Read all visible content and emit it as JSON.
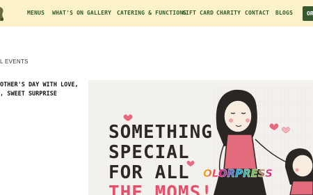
{
  "header": {
    "nav_items": [
      "MENUS",
      "WHAT'S ON",
      "GALLERY",
      "CATERING & FUNCTIONS",
      "GIFT CARD",
      "CHARITY",
      "CONTACT",
      "BLOGS"
    ],
    "order_button_label": "OR"
  },
  "breadcrumb": {
    "text": "L EVENTS"
  },
  "post": {
    "title": "OTHER'S DAY WITH LOVE,\n, SWEET SURPRISE"
  },
  "hero": {
    "lines": [
      "SOMETHING",
      "SPECIAL",
      "FOR ALL",
      "THE MOMS!"
    ]
  },
  "watermark": {
    "text": "OLORPRESS"
  },
  "colors": {
    "header_background": "#fcf2c9",
    "nav_text": "#2f5a2a",
    "order_button": "#365a2e",
    "accent_pink": "#e5506a"
  }
}
